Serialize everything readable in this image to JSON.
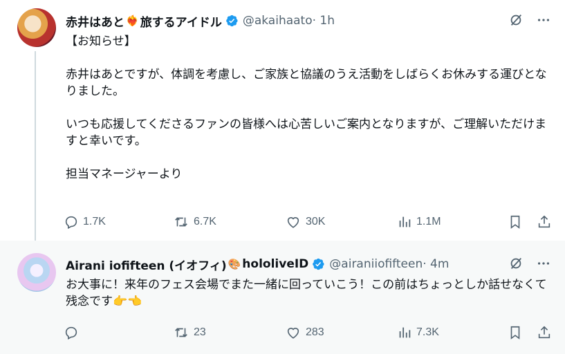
{
  "tweet1": {
    "display_name": "赤井はあと",
    "emoji": "❤️‍🔥",
    "display_name_suffix": "旅するアイドル",
    "handle": "@akaihaato",
    "time": " · 1h",
    "text": "【お知らせ】\n\n赤井はあとですが、体調を考慮し、ご家族と協議のうえ活動をしばらくお休みする運びとなりました。\n\nいつも応援してくださるファンの皆様へは心苦しいご案内となりますが、ご理解いただけますと幸いです。\n\n担当マネージャーより",
    "replies": "1.7K",
    "retweets": "6.7K",
    "likes": "30K",
    "views": "1.1M"
  },
  "tweet2": {
    "display_name": "Airani iofifteen (イオフィ)",
    "emoji": "🎨",
    "display_name_suffix": "hololiveID",
    "handle": "@airaniiofifteen",
    "time": " · 4m",
    "text": "お大事に！来年のフェス会場でまた一緒に回っていこう！この前はちょっとしか話せなくて残念です👉👈",
    "replies": "",
    "retweets": "23",
    "likes": "283",
    "views": "7.3K"
  },
  "colors": {
    "verified": "#1d9bf0",
    "muted": "#536471",
    "text": "#0f1419",
    "reply_bg": "#f7f9f9"
  },
  "icons": [
    "verified-icon",
    "grok-icon",
    "more-icon",
    "reply-icon",
    "retweet-icon",
    "like-icon",
    "views-icon",
    "bookmark-icon",
    "share-icon"
  ]
}
